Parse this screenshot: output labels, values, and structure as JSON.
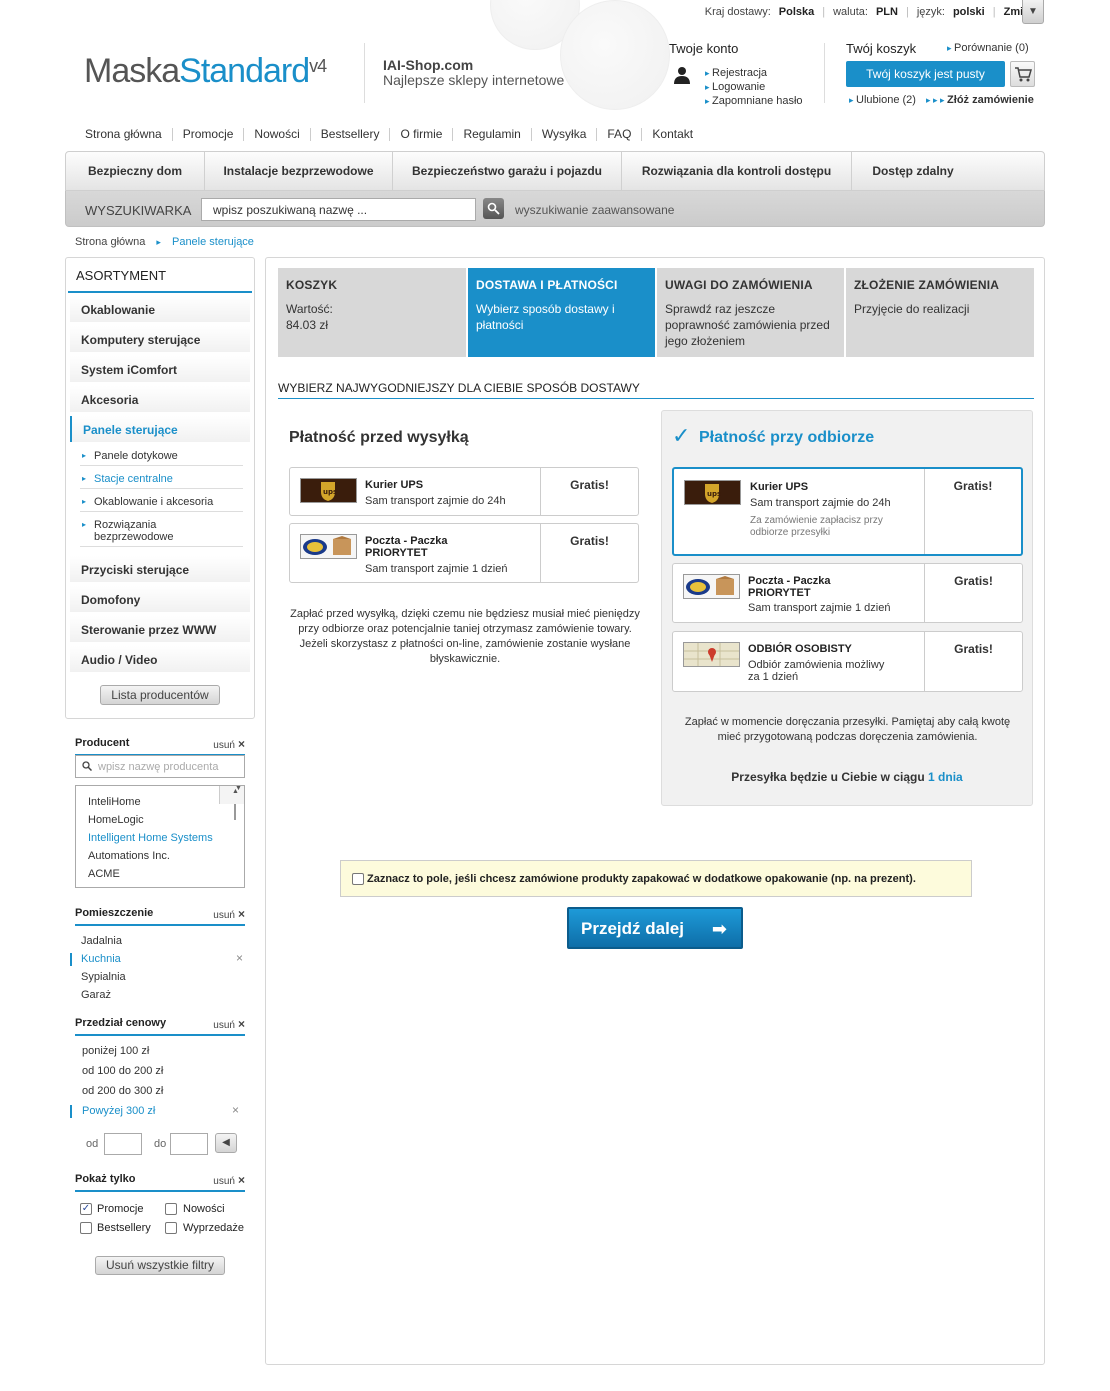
{
  "topbar": {
    "country_label": "Kraj dostawy:",
    "country": "Polska",
    "currency_label": "waluta:",
    "currency": "PLN",
    "lang_label": "język:",
    "lang": "polski",
    "change": "Zmień",
    "dropdown": "▼"
  },
  "logo": {
    "part1": "Maska",
    "part2": "Standard",
    "ver": "v4"
  },
  "tagline": {
    "shop": "IAI-Shop.com",
    "desc": "Najlepsze sklepy internetowe"
  },
  "account": {
    "title": "Twoje konto",
    "links": [
      "Rejestracja",
      "Logowanie",
      "Zapomniane hasło"
    ]
  },
  "cart": {
    "title": "Twój koszyk",
    "compare": "Porównanie (0)",
    "button": "Twój koszyk jest pusty",
    "fav": "Ulubione (2)",
    "order": "Złóż zamówienie"
  },
  "menu": [
    "Strona główna",
    "Promocje",
    "Nowości",
    "Bestsellery",
    "O firmie",
    "Regulamin",
    "Wysyłka",
    "FAQ",
    "Kontakt"
  ],
  "categories": [
    "Bezpieczny dom",
    "Instalacje bezprzewodowe",
    "Bezpieczeństwo garażu i pojazdu",
    "Rozwiązania dla  kontroli dostępu",
    "Dostęp zdalny"
  ],
  "search": {
    "label": "WYSZUKIWARKA",
    "value": "wpisz poszukiwaną nazwę ...",
    "advanced": "wyszukiwanie zaawansowane"
  },
  "breadcrumb": {
    "home": "Strona główna",
    "current": "Panele sterujące"
  },
  "sidebar": {
    "title": "ASORTYMENT",
    "items": [
      "Okablowanie",
      "Komputery sterujące",
      "System iComfort",
      "Akcesoria",
      "Panele sterujące"
    ],
    "subitems": [
      "Panele dotykowe",
      "Stacje centralne",
      "Okablowanie i akcesoria",
      "Rozwiązania bezprzewodowe"
    ],
    "items2": [
      "Przyciski sterujące",
      "Domofony",
      "Sterowanie przez WWW",
      "Audio / Video"
    ],
    "producers_btn": "Lista producentów"
  },
  "filters": {
    "clear": "usuń",
    "producer": {
      "title": "Producent",
      "placeholder": "wpisz nazwę producenta",
      "list": [
        "InteliHome",
        "HomeLogic",
        "Intelligent Home Systems",
        "Automations Inc.",
        "ACME"
      ]
    },
    "room": {
      "title": "Pomieszczenie",
      "list": [
        "Jadalnia",
        "Kuchnia",
        "Sypialnia",
        "Garaż"
      ]
    },
    "price": {
      "title": "Przedział cenowy",
      "list": [
        "poniżej 100 zł",
        "od 100 do 200 zł",
        "od 200 do 300 zł",
        "Powyżej 300 zł"
      ],
      "from": "od",
      "to": "do"
    },
    "show": {
      "title": "Pokaż tylko",
      "options": [
        "Promocje",
        "Nowości",
        "Bestsellery",
        "Wyprzedaże"
      ]
    },
    "clear_all": "Usuń wszystkie filtry"
  },
  "steps": [
    {
      "title": "KOSZYK",
      "line1": "Wartość:",
      "line2": "84.03 zł"
    },
    {
      "title": "DOSTAWA I PŁATNOŚCI",
      "desc": "Wybierz sposób dostawy i płatności"
    },
    {
      "title": "UWAGI DO ZAMÓWIENIA",
      "desc": "Sprawdź raz jeszcze poprawność zamówienia przed jego złożeniem"
    },
    {
      "title": "ZŁOŻENIE ZAMÓWIENIA",
      "desc": "Przyjęcie do realizacji"
    }
  ],
  "delivery": {
    "section": "WYBIERZ NAJWYGODNIEJSZY DLA CIEBIE SPOSÓB DOSTAWY",
    "prepay": {
      "title": "Płatność przed wysyłką",
      "opts": [
        {
          "name": "Kurier UPS",
          "desc": "Sam transport zajmie do 24h",
          "price": "Gratis!"
        },
        {
          "name1": "Poczta - Paczka",
          "name2": "PRIORYTET",
          "desc": "Sam transport zajmie 1 dzień",
          "price": "Gratis!"
        }
      ],
      "note": "Zapłać przed wysyłką, dzięki czemu nie będziesz musiał mieć pieniędzy przy odbiorze oraz potencjalnie taniej otrzymasz zamówienie towary. Jeżeli skorzystasz z płatności on-line, zamówienie zostanie wysłane błyskawicznie."
    },
    "cod": {
      "check": "✓",
      "title": "Płatność przy odbiorze",
      "opts": [
        {
          "name": "Kurier UPS",
          "desc": "Sam transport zajmie do 24h",
          "extra": "Za zamówienie zapłacisz przy odbiorze przesyłki",
          "price": "Gratis!"
        },
        {
          "name1": "Poczta - Paczka",
          "name2": "PRIORYTET",
          "desc": "Sam transport zajmie 1 dzień",
          "price": "Gratis!"
        },
        {
          "name": "ODBIÓR OSOBISTY",
          "desc": "Odbiór zamówienia możliwy za 1 dzień",
          "price": "Gratis!"
        }
      ],
      "note": "Zapłać w momencie doręczania przesyłki. Pamiętaj aby całą kwotę mieć przygotowaną podczas doręczenia zamówienia.",
      "eta_label": "Przesyłka będzie u Ciebie w ciągu",
      "eta": "1 dnia"
    }
  },
  "gift": "Zaznacz to pole, jeśli chcesz zamówione produkty zapakować w dodatkowe opakowanie (np. na prezent).",
  "next": "Przejdź dalej",
  "colors": {
    "accent": "#1a8fc9"
  }
}
